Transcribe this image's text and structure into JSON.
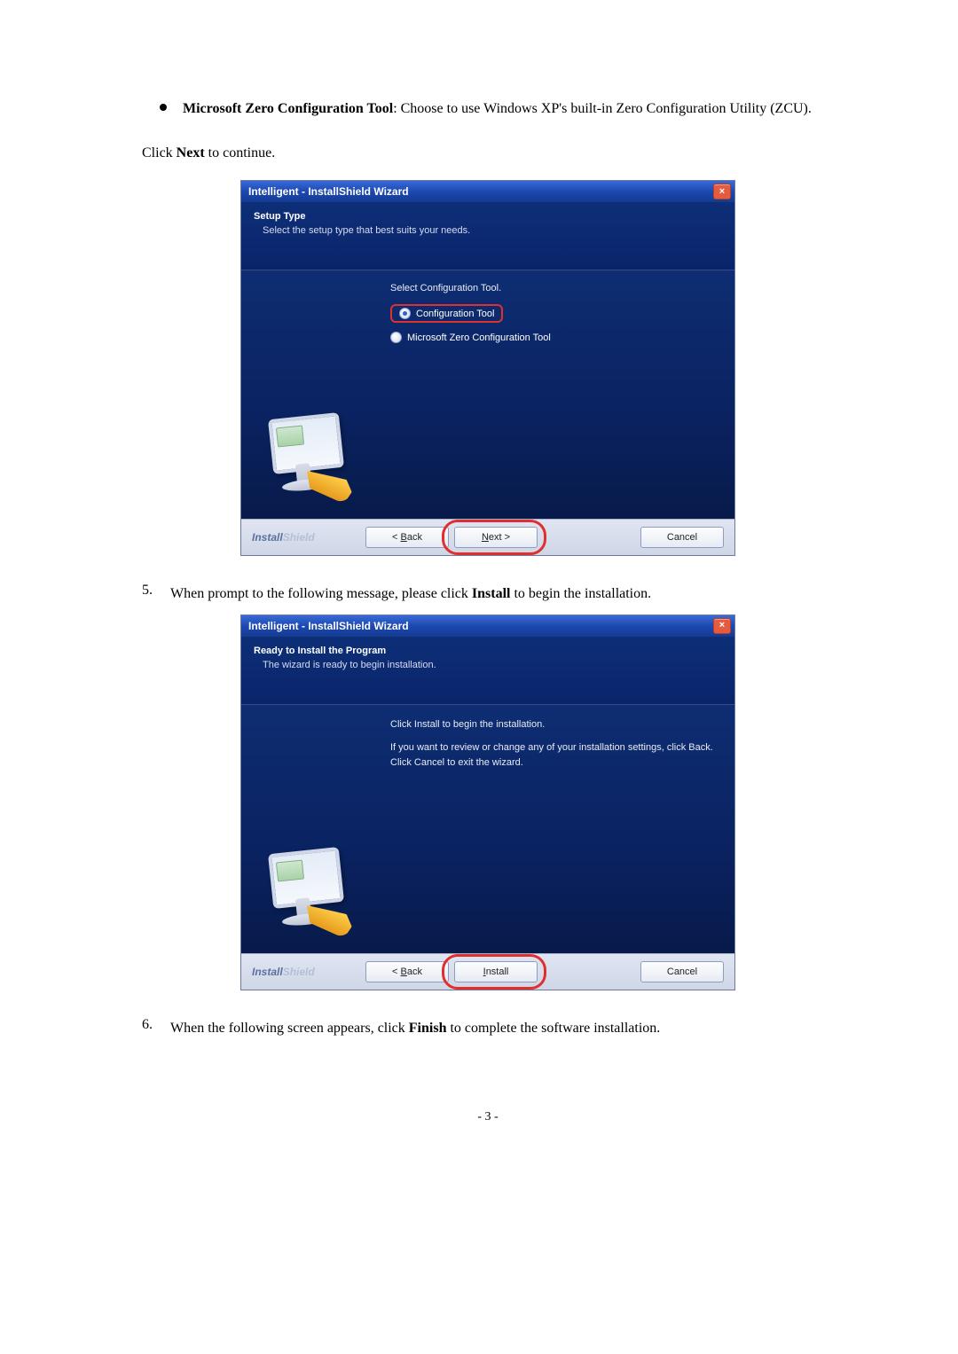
{
  "doc": {
    "bullet_label": "Microsoft Zero Configuration Tool",
    "bullet_rest": ": Choose to use Windows XP's built-in Zero Configuration Utility (ZCU).",
    "click_next_1": "Click ",
    "click_next_bold": "Next",
    "click_next_2": " to continue.",
    "step5_num": "5.",
    "step5_1": "When prompt to the following message, please click ",
    "step5_bold": "Install",
    "step5_2": " to begin the installation.",
    "step6_num": "6.",
    "step6_1": "When the following screen appears, click ",
    "step6_bold": "Finish",
    "step6_2": " to complete the software installation.",
    "page_no": "- 3 -"
  },
  "wiz1": {
    "title": "Intelligent - InstallShield Wizard",
    "hdr_title": "Setup Type",
    "hdr_sub": "Select the setup type that best suits your needs.",
    "prompt": "Select Configuration Tool.",
    "opt1": "Configuration Tool",
    "opt2": "Microsoft Zero Configuration Tool",
    "brand1": "Install",
    "brand2": "Shield",
    "back": "< Back",
    "next": "Next >",
    "cancel": "Cancel"
  },
  "wiz2": {
    "title": "Intelligent - InstallShield Wizard",
    "hdr_title": "Ready to Install the Program",
    "hdr_sub": "The wizard is ready to begin installation.",
    "line1": "Click Install to begin the installation.",
    "line2": "If you want to review or change any of your installation settings, click Back. Click Cancel to exit the wizard.",
    "brand1": "Install",
    "brand2": "Shield",
    "back": "< Back",
    "install": "Install",
    "cancel": "Cancel"
  }
}
